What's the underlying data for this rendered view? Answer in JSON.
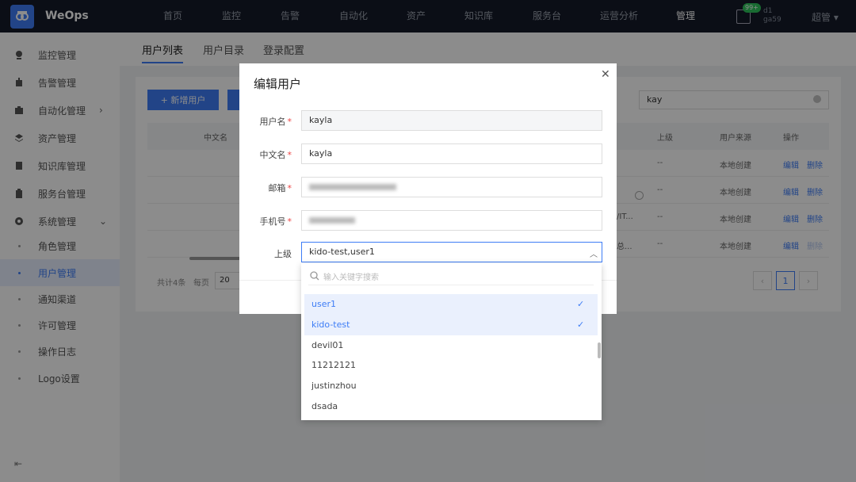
{
  "app": {
    "name": "WeOps"
  },
  "topnav": {
    "items": [
      "首页",
      "监控",
      "告警",
      "自动化",
      "资产",
      "知识库",
      "服务台",
      "运营分析",
      "管理"
    ],
    "active": "管理",
    "badge": "99+",
    "user_line1": "d1",
    "user_line2": "ga59",
    "user_name": "超管"
  },
  "sidebar": {
    "items": [
      {
        "label": "监控管理"
      },
      {
        "label": "告警管理"
      },
      {
        "label": "自动化管理"
      },
      {
        "label": "资产管理"
      },
      {
        "label": "知识库管理"
      },
      {
        "label": "服务台管理"
      },
      {
        "label": "系统管理"
      }
    ],
    "sub_items": [
      "角色管理",
      "用户管理",
      "通知渠道",
      "许可管理",
      "操作日志",
      "Logo设置"
    ],
    "active": "用户管理"
  },
  "tabs": [
    "用户列表",
    "用户目录",
    "登录配置"
  ],
  "toolbar": {
    "add_user": "+ 新增用户",
    "search_value": "kay"
  },
  "table": {
    "headers": [
      "中文名",
      "上级",
      "用户来源",
      "操作"
    ],
    "rows": [
      {
        "cell": "",
        "superior": "--",
        "source": "本地创建",
        "edit": "编辑",
        "delete": "删除"
      },
      {
        "cell": "",
        "superior": "--",
        "source": "本地创建",
        "edit": "编辑",
        "delete": "删除"
      },
      {
        "cell": "/IT...",
        "superior": "--",
        "source": "本地创建",
        "edit": "编辑",
        "delete": "删除"
      },
      {
        "cell": "总...",
        "superior": "--",
        "source": "本地创建",
        "edit": "编辑",
        "delete": "删除"
      }
    ],
    "total": "共计4条",
    "per_page_label": "每页",
    "per_page": "20",
    "page": "1"
  },
  "modal": {
    "title": "编辑用户",
    "fields": {
      "username": {
        "label": "用户名",
        "value": "kayla"
      },
      "cn_name": {
        "label": "中文名",
        "value": "kayla"
      },
      "email": {
        "label": "邮箱"
      },
      "phone": {
        "label": "手机号"
      },
      "superior": {
        "label": "上级",
        "value": "kido-test,user1"
      }
    },
    "required_mark": "*"
  },
  "dropdown": {
    "placeholder": "输入关键字搜索",
    "options": [
      {
        "label": "user1",
        "selected": true
      },
      {
        "label": "kido-test",
        "selected": true
      },
      {
        "label": "devil01",
        "selected": false
      },
      {
        "label": "11212121",
        "selected": false
      },
      {
        "label": "justinzhou",
        "selected": false
      },
      {
        "label": "dsada",
        "selected": false
      }
    ]
  },
  "colors": {
    "primary": "#3e7df6",
    "topbar": "#151a28",
    "required": "#ee4444"
  }
}
